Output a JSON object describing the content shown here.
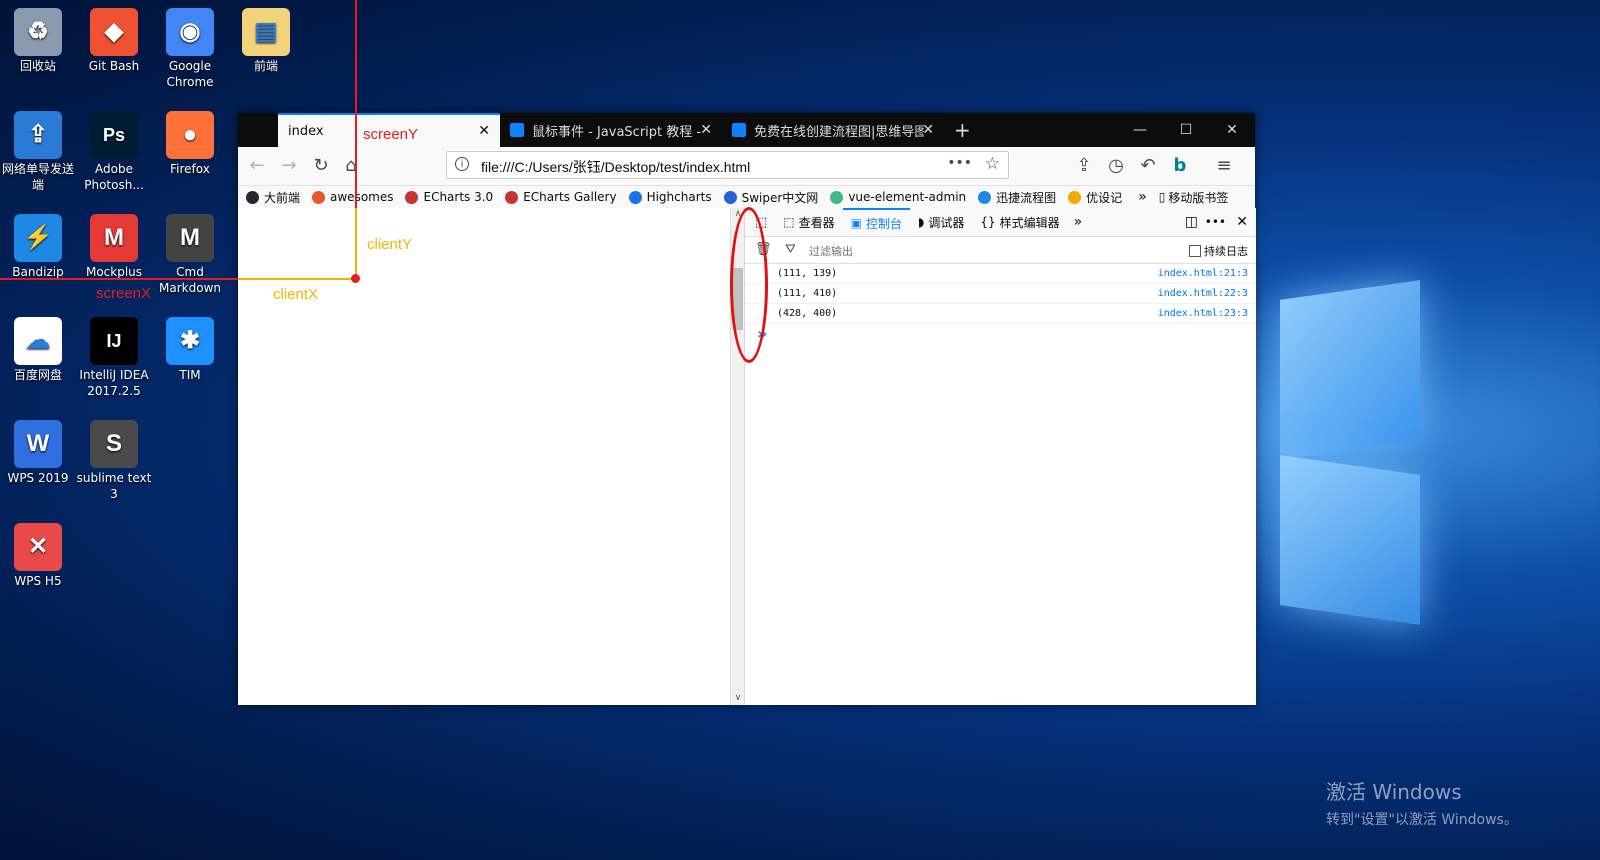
{
  "desktop": {
    "icons": [
      {
        "label": "回收站",
        "icon": "recycle-bin-icon",
        "color": "#8a9bb0",
        "glyph": "♻"
      },
      {
        "label": "Git Bash",
        "icon": "git-bash-icon",
        "color": "#f05133",
        "glyph": "◆"
      },
      {
        "label": "Google Chrome",
        "icon": "chrome-icon",
        "color": "#4285f4",
        "glyph": "◉"
      },
      {
        "label": "前端",
        "icon": "folder-icon",
        "color": "#f3d37a",
        "glyph": "▤"
      },
      {
        "label": "网络单导发送端",
        "icon": "network-send-icon",
        "color": "#2a7bd6",
        "glyph": "⇪"
      },
      {
        "label": "Adobe Photosh...",
        "icon": "photoshop-icon",
        "color": "#001d34",
        "glyph": "Ps"
      },
      {
        "label": "Firefox",
        "icon": "firefox-icon",
        "color": "#ff7139",
        "glyph": "●"
      },
      {
        "label": "Bandizip",
        "icon": "bandizip-icon",
        "color": "#1e88e5",
        "glyph": "⚡"
      },
      {
        "label": "Mockplus",
        "icon": "mockplus-icon",
        "color": "#e53935",
        "glyph": "M"
      },
      {
        "label": "Cmd Markdown",
        "icon": "cmd-markdown-icon",
        "color": "#444444",
        "glyph": "M"
      },
      {
        "label": "百度网盘",
        "icon": "baidu-netdisk-icon",
        "color": "#ffffff",
        "glyph": "☁"
      },
      {
        "label": "IntelliJ IDEA 2017.2.5",
        "icon": "intellij-icon",
        "color": "#000000",
        "glyph": "IJ"
      },
      {
        "label": "TIM",
        "icon": "tim-icon",
        "color": "#1e90ff",
        "glyph": "✱"
      },
      {
        "label": "WPS 2019",
        "icon": "wps-icon",
        "color": "#2f6fdf",
        "glyph": "W"
      },
      {
        "label": "sublime text 3",
        "icon": "sublime-icon",
        "color": "#4a4a4a",
        "glyph": "S"
      },
      {
        "label": "WPS H5",
        "icon": "wps-h5-icon",
        "color": "#e84a4a",
        "glyph": "✕"
      }
    ],
    "watermark_line1": "激活 Windows",
    "watermark_line2": "转到\"设置\"以激活 Windows。"
  },
  "browser": {
    "tabs": [
      {
        "title": "index",
        "active": true
      },
      {
        "title": "鼠标事件 - JavaScript 教程 - F",
        "active": false
      },
      {
        "title": "免费在线创建流程图|思维导图",
        "active": false
      }
    ],
    "new_tab": "+",
    "win_min": "—",
    "win_max": "☐",
    "win_close": "✕",
    "url": "file:///C:/Users/张钰/Desktop/test/index.html",
    "bookmarks": [
      {
        "label": "大前端",
        "color": "#24292e"
      },
      {
        "label": "awesomes",
        "color": "#e8572a"
      },
      {
        "label": "ECharts 3.0",
        "color": "#c23531"
      },
      {
        "label": "ECharts Gallery",
        "color": "#c23531"
      },
      {
        "label": "Highcharts",
        "color": "#1a73e8"
      },
      {
        "label": "Swiper中文网",
        "color": "#2b5fd9"
      },
      {
        "label": "vue-element-admin",
        "color": "#41b883"
      },
      {
        "label": "迅捷流程图",
        "color": "#1e88e5"
      },
      {
        "label": "优设记",
        "color": "#f2a900"
      }
    ],
    "bookmarks_more": "»",
    "mobile_bookmarks": "移动版书签"
  },
  "devtools": {
    "tabs": [
      {
        "label": "查看器",
        "icon": "inspector-icon",
        "glyph": "⬚"
      },
      {
        "label": "控制台",
        "icon": "console-icon",
        "glyph": "▣"
      },
      {
        "label": "调试器",
        "icon": "debugger-icon",
        "glyph": "◗"
      },
      {
        "label": "样式编辑器",
        "icon": "style-editor-icon",
        "glyph": "{}"
      }
    ],
    "filter_placeholder": "过滤输出",
    "persist_logs": "持续日志",
    "logs": [
      {
        "message": "(111, 139)",
        "source": "index.html:21:3"
      },
      {
        "message": "(111, 410)",
        "source": "index.html:22:3"
      },
      {
        "message": "(428, 400)",
        "source": "index.html:23:3"
      }
    ],
    "prompt": "»"
  },
  "annotations": {
    "screenY": "screenY",
    "screenX": "screenX",
    "clientY": "clientY",
    "clientX": "clientX",
    "red": "#e02020",
    "yellow": "#f2b400"
  }
}
